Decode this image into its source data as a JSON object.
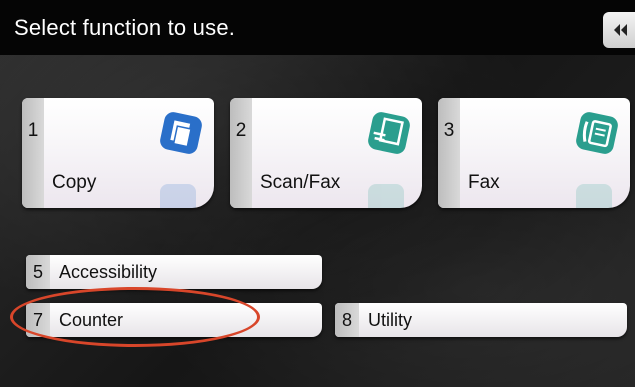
{
  "header": {
    "title": "Select function to use.",
    "back_icon": "double-chevron-left-icon"
  },
  "tiles": [
    {
      "number": "1",
      "label": "Copy",
      "icon": "copy-icon",
      "accent": "#2a6fc9"
    },
    {
      "number": "2",
      "label": "Scan/Fax",
      "icon": "scan-fax-icon",
      "accent": "#2a9e8e"
    },
    {
      "number": "3",
      "label": "Fax",
      "icon": "fax-icon",
      "accent": "#2a9e8e"
    }
  ],
  "buttons": [
    {
      "number": "5",
      "label": "Accessibility"
    },
    {
      "number": "7",
      "label": "Counter"
    },
    {
      "number": "8",
      "label": "Utility"
    }
  ],
  "highlight": {
    "target": "Counter",
    "color": "#d8462a"
  }
}
